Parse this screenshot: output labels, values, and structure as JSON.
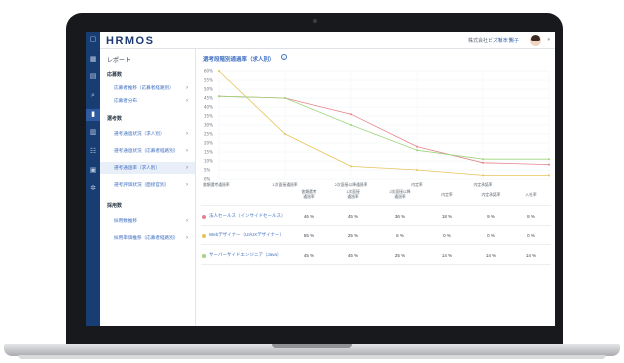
{
  "app": {
    "logo": "HRMOS",
    "company": "株式会社ビズリーチ",
    "user_name": "坂本 陽子"
  },
  "sidebar": {
    "title": "レポート",
    "sections": [
      {
        "heading": "応募数",
        "items": [
          {
            "label": "応募者推移（応募者経路別）"
          },
          {
            "label": "応募者分布"
          }
        ]
      },
      {
        "heading": "選考数",
        "items": [
          {
            "label": "選考通過状況（求人別）"
          },
          {
            "label": "選考通過状況（応募者経路別）"
          },
          {
            "label": "選考通過率（求人別）",
            "selected": true
          },
          {
            "label": "選考評価状況（面接官別）"
          }
        ]
      },
      {
        "heading": "採用数",
        "items": [
          {
            "label": "採用数推移"
          },
          {
            "label": "採用単価推移（応募者経路別）"
          }
        ]
      }
    ]
  },
  "main": {
    "title": "選考段階別通過率（求人別）",
    "info_glyph": "i"
  },
  "chart_data": {
    "type": "line",
    "ylim": [
      0,
      60
    ],
    "yticks": [
      "0%",
      "5%",
      "10%",
      "15%",
      "20%",
      "25%",
      "30%",
      "35%",
      "40%",
      "45%",
      "50%",
      "55%",
      "60%"
    ],
    "categories": [
      "書類選考通過率",
      "1次面接通過率",
      "2次面接以降通過率",
      "内定率",
      "内定承諾率"
    ],
    "series": [
      {
        "color": "#e8828a",
        "values": [
          46,
          45,
          36,
          18,
          9,
          8
        ]
      },
      {
        "color": "#e6c35a",
        "values": [
          60,
          25,
          7,
          5,
          2,
          2
        ]
      },
      {
        "color": "#9ed67a",
        "values": [
          46,
          45,
          30,
          16,
          11,
          11
        ]
      }
    ]
  },
  "table": {
    "headers": [
      "",
      "書類選考\n通過率",
      "1次面接\n通過率",
      "2次面接以降\n通過率",
      "内定率",
      "内定承諾率",
      "入社率"
    ],
    "rows": [
      {
        "color": "#e8828a",
        "label": "法人セールス（インサイドセールス）",
        "cells": [
          "46 %",
          "45 %",
          "36 %",
          "18 %",
          "9 %",
          "8 %"
        ]
      },
      {
        "color": "#e6c35a",
        "label": "Webデザイナー（UI/UXデザイナー）",
        "cells": [
          "55 %",
          "25 %",
          "6 %",
          "0 %",
          "0 %",
          "0 %"
        ]
      },
      {
        "color": "#9ed67a",
        "label": "サーバーサイドエンジニア（Java）",
        "cells": [
          "45 %",
          "45 %",
          "25 %",
          "14 %",
          "14 %",
          "14 %"
        ]
      }
    ]
  },
  "icons": {
    "sidebar_icons": [
      "menu-icon",
      "dashboard-icon",
      "document-icon",
      "search-icon",
      "report-icon",
      "building-icon",
      "people-icon",
      "calendar-icon",
      "settings-icon"
    ]
  }
}
